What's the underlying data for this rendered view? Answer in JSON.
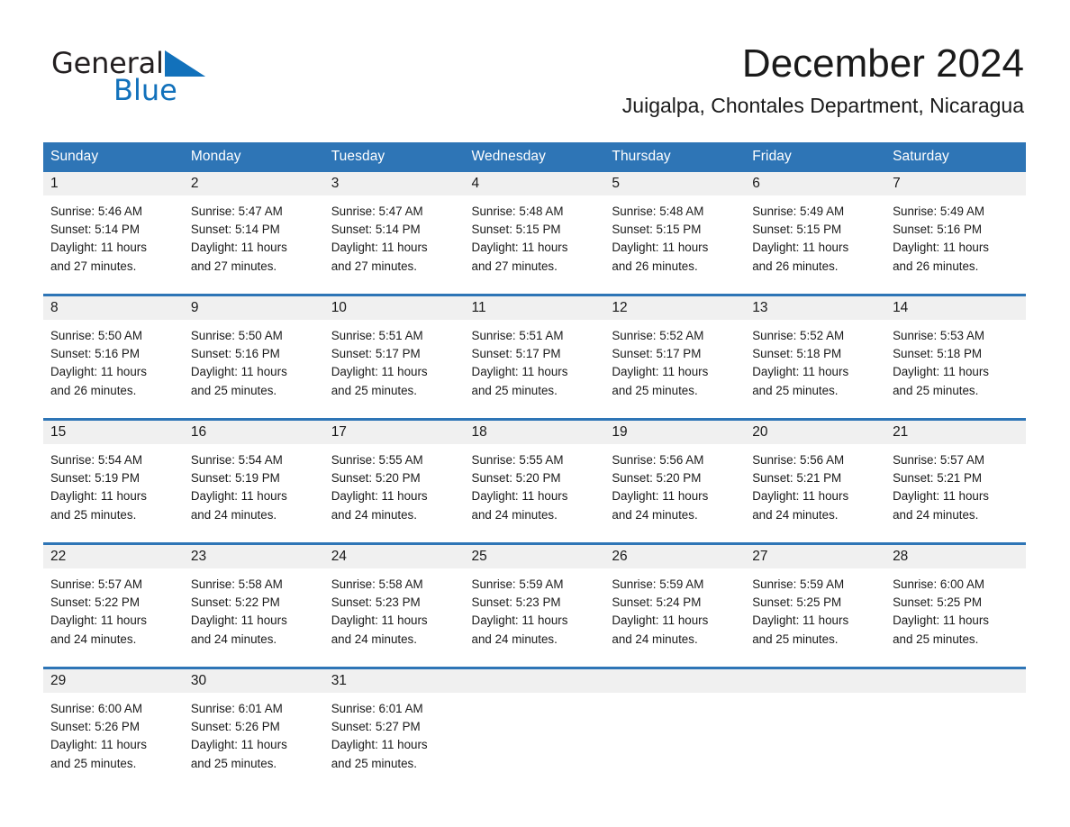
{
  "brand": {
    "name_part1": "General",
    "name_part2": "Blue",
    "triangle_color": "#1271bb"
  },
  "header": {
    "month_title": "December 2024",
    "location": "Juigalpa, Chontales Department, Nicaragua"
  },
  "colors": {
    "header_blue": "#2e75b6",
    "daynum_band": "#f0f0f0",
    "text": "#1a1a1a"
  },
  "weekday_headers": [
    "Sunday",
    "Monday",
    "Tuesday",
    "Wednesday",
    "Thursday",
    "Friday",
    "Saturday"
  ],
  "weeks": [
    [
      {
        "day": "1",
        "sunrise": "Sunrise: 5:46 AM",
        "sunset": "Sunset: 5:14 PM",
        "daylight_line1": "Daylight: 11 hours",
        "daylight_line2": "and 27 minutes."
      },
      {
        "day": "2",
        "sunrise": "Sunrise: 5:47 AM",
        "sunset": "Sunset: 5:14 PM",
        "daylight_line1": "Daylight: 11 hours",
        "daylight_line2": "and 27 minutes."
      },
      {
        "day": "3",
        "sunrise": "Sunrise: 5:47 AM",
        "sunset": "Sunset: 5:14 PM",
        "daylight_line1": "Daylight: 11 hours",
        "daylight_line2": "and 27 minutes."
      },
      {
        "day": "4",
        "sunrise": "Sunrise: 5:48 AM",
        "sunset": "Sunset: 5:15 PM",
        "daylight_line1": "Daylight: 11 hours",
        "daylight_line2": "and 27 minutes."
      },
      {
        "day": "5",
        "sunrise": "Sunrise: 5:48 AM",
        "sunset": "Sunset: 5:15 PM",
        "daylight_line1": "Daylight: 11 hours",
        "daylight_line2": "and 26 minutes."
      },
      {
        "day": "6",
        "sunrise": "Sunrise: 5:49 AM",
        "sunset": "Sunset: 5:15 PM",
        "daylight_line1": "Daylight: 11 hours",
        "daylight_line2": "and 26 minutes."
      },
      {
        "day": "7",
        "sunrise": "Sunrise: 5:49 AM",
        "sunset": "Sunset: 5:16 PM",
        "daylight_line1": "Daylight: 11 hours",
        "daylight_line2": "and 26 minutes."
      }
    ],
    [
      {
        "day": "8",
        "sunrise": "Sunrise: 5:50 AM",
        "sunset": "Sunset: 5:16 PM",
        "daylight_line1": "Daylight: 11 hours",
        "daylight_line2": "and 26 minutes."
      },
      {
        "day": "9",
        "sunrise": "Sunrise: 5:50 AM",
        "sunset": "Sunset: 5:16 PM",
        "daylight_line1": "Daylight: 11 hours",
        "daylight_line2": "and 25 minutes."
      },
      {
        "day": "10",
        "sunrise": "Sunrise: 5:51 AM",
        "sunset": "Sunset: 5:17 PM",
        "daylight_line1": "Daylight: 11 hours",
        "daylight_line2": "and 25 minutes."
      },
      {
        "day": "11",
        "sunrise": "Sunrise: 5:51 AM",
        "sunset": "Sunset: 5:17 PM",
        "daylight_line1": "Daylight: 11 hours",
        "daylight_line2": "and 25 minutes."
      },
      {
        "day": "12",
        "sunrise": "Sunrise: 5:52 AM",
        "sunset": "Sunset: 5:17 PM",
        "daylight_line1": "Daylight: 11 hours",
        "daylight_line2": "and 25 minutes."
      },
      {
        "day": "13",
        "sunrise": "Sunrise: 5:52 AM",
        "sunset": "Sunset: 5:18 PM",
        "daylight_line1": "Daylight: 11 hours",
        "daylight_line2": "and 25 minutes."
      },
      {
        "day": "14",
        "sunrise": "Sunrise: 5:53 AM",
        "sunset": "Sunset: 5:18 PM",
        "daylight_line1": "Daylight: 11 hours",
        "daylight_line2": "and 25 minutes."
      }
    ],
    [
      {
        "day": "15",
        "sunrise": "Sunrise: 5:54 AM",
        "sunset": "Sunset: 5:19 PM",
        "daylight_line1": "Daylight: 11 hours",
        "daylight_line2": "and 25 minutes."
      },
      {
        "day": "16",
        "sunrise": "Sunrise: 5:54 AM",
        "sunset": "Sunset: 5:19 PM",
        "daylight_line1": "Daylight: 11 hours",
        "daylight_line2": "and 24 minutes."
      },
      {
        "day": "17",
        "sunrise": "Sunrise: 5:55 AM",
        "sunset": "Sunset: 5:20 PM",
        "daylight_line1": "Daylight: 11 hours",
        "daylight_line2": "and 24 minutes."
      },
      {
        "day": "18",
        "sunrise": "Sunrise: 5:55 AM",
        "sunset": "Sunset: 5:20 PM",
        "daylight_line1": "Daylight: 11 hours",
        "daylight_line2": "and 24 minutes."
      },
      {
        "day": "19",
        "sunrise": "Sunrise: 5:56 AM",
        "sunset": "Sunset: 5:20 PM",
        "daylight_line1": "Daylight: 11 hours",
        "daylight_line2": "and 24 minutes."
      },
      {
        "day": "20",
        "sunrise": "Sunrise: 5:56 AM",
        "sunset": "Sunset: 5:21 PM",
        "daylight_line1": "Daylight: 11 hours",
        "daylight_line2": "and 24 minutes."
      },
      {
        "day": "21",
        "sunrise": "Sunrise: 5:57 AM",
        "sunset": "Sunset: 5:21 PM",
        "daylight_line1": "Daylight: 11 hours",
        "daylight_line2": "and 24 minutes."
      }
    ],
    [
      {
        "day": "22",
        "sunrise": "Sunrise: 5:57 AM",
        "sunset": "Sunset: 5:22 PM",
        "daylight_line1": "Daylight: 11 hours",
        "daylight_line2": "and 24 minutes."
      },
      {
        "day": "23",
        "sunrise": "Sunrise: 5:58 AM",
        "sunset": "Sunset: 5:22 PM",
        "daylight_line1": "Daylight: 11 hours",
        "daylight_line2": "and 24 minutes."
      },
      {
        "day": "24",
        "sunrise": "Sunrise: 5:58 AM",
        "sunset": "Sunset: 5:23 PM",
        "daylight_line1": "Daylight: 11 hours",
        "daylight_line2": "and 24 minutes."
      },
      {
        "day": "25",
        "sunrise": "Sunrise: 5:59 AM",
        "sunset": "Sunset: 5:23 PM",
        "daylight_line1": "Daylight: 11 hours",
        "daylight_line2": "and 24 minutes."
      },
      {
        "day": "26",
        "sunrise": "Sunrise: 5:59 AM",
        "sunset": "Sunset: 5:24 PM",
        "daylight_line1": "Daylight: 11 hours",
        "daylight_line2": "and 24 minutes."
      },
      {
        "day": "27",
        "sunrise": "Sunrise: 5:59 AM",
        "sunset": "Sunset: 5:25 PM",
        "daylight_line1": "Daylight: 11 hours",
        "daylight_line2": "and 25 minutes."
      },
      {
        "day": "28",
        "sunrise": "Sunrise: 6:00 AM",
        "sunset": "Sunset: 5:25 PM",
        "daylight_line1": "Daylight: 11 hours",
        "daylight_line2": "and 25 minutes."
      }
    ],
    [
      {
        "day": "29",
        "sunrise": "Sunrise: 6:00 AM",
        "sunset": "Sunset: 5:26 PM",
        "daylight_line1": "Daylight: 11 hours",
        "daylight_line2": "and 25 minutes."
      },
      {
        "day": "30",
        "sunrise": "Sunrise: 6:01 AM",
        "sunset": "Sunset: 5:26 PM",
        "daylight_line1": "Daylight: 11 hours",
        "daylight_line2": "and 25 minutes."
      },
      {
        "day": "31",
        "sunrise": "Sunrise: 6:01 AM",
        "sunset": "Sunset: 5:27 PM",
        "daylight_line1": "Daylight: 11 hours",
        "daylight_line2": "and 25 minutes."
      },
      {
        "day": "",
        "sunrise": "",
        "sunset": "",
        "daylight_line1": "",
        "daylight_line2": ""
      },
      {
        "day": "",
        "sunrise": "",
        "sunset": "",
        "daylight_line1": "",
        "daylight_line2": ""
      },
      {
        "day": "",
        "sunrise": "",
        "sunset": "",
        "daylight_line1": "",
        "daylight_line2": ""
      },
      {
        "day": "",
        "sunrise": "",
        "sunset": "",
        "daylight_line1": "",
        "daylight_line2": ""
      }
    ]
  ]
}
